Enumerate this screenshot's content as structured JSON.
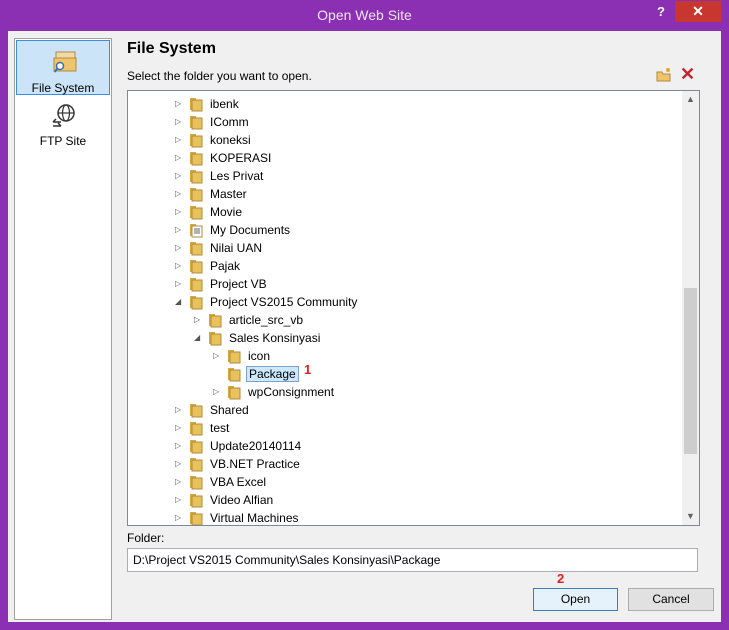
{
  "window": {
    "title": "Open Web Site",
    "help_label": "?",
    "close_label": "✕"
  },
  "nav": {
    "items": [
      {
        "label": "File System",
        "selected": true
      },
      {
        "label": "FTP Site",
        "selected": false
      }
    ]
  },
  "heading": "File System",
  "instruction": "Select the folder you want to open.",
  "tree": {
    "rows": [
      {
        "label": "ibenk",
        "level": 0,
        "arrow": "▷"
      },
      {
        "label": "IComm",
        "level": 0,
        "arrow": "▷"
      },
      {
        "label": "koneksi",
        "level": 0,
        "arrow": "▷"
      },
      {
        "label": "KOPERASI",
        "level": 0,
        "arrow": "▷"
      },
      {
        "label": "Les Privat",
        "level": 0,
        "arrow": "▷"
      },
      {
        "label": "Master",
        "level": 0,
        "arrow": "▷"
      },
      {
        "label": "Movie",
        "level": 0,
        "arrow": "▷"
      },
      {
        "label": "My Documents",
        "level": 0,
        "arrow": "▷",
        "icon": "doc"
      },
      {
        "label": "Nilai UAN",
        "level": 0,
        "arrow": "▷"
      },
      {
        "label": "Pajak",
        "level": 0,
        "arrow": "▷"
      },
      {
        "label": "Project VB",
        "level": 0,
        "arrow": "▷"
      },
      {
        "label": "Project VS2015 Community",
        "level": 0,
        "arrow": "◢"
      },
      {
        "label": "article_src_vb",
        "level": 1,
        "arrow": "▷"
      },
      {
        "label": "Sales Konsinyasi",
        "level": 1,
        "arrow": "◢"
      },
      {
        "label": "icon",
        "level": 2,
        "arrow": "▷"
      },
      {
        "label": "Package",
        "level": 2,
        "arrow": "",
        "selected": true
      },
      {
        "label": "wpConsignment",
        "level": 2,
        "arrow": "▷"
      },
      {
        "label": "Shared",
        "level": 0,
        "arrow": "▷"
      },
      {
        "label": "test",
        "level": 0,
        "arrow": "▷"
      },
      {
        "label": "Update20140114",
        "level": 0,
        "arrow": "▷"
      },
      {
        "label": "VB.NET Practice",
        "level": 0,
        "arrow": "▷"
      },
      {
        "label": "VBA Excel",
        "level": 0,
        "arrow": "▷"
      },
      {
        "label": "Video Alfian",
        "level": 0,
        "arrow": "▷"
      },
      {
        "label": "Virtual Machines",
        "level": 0,
        "arrow": "▷"
      }
    ]
  },
  "annotations": {
    "one": "1",
    "two": "2"
  },
  "folder": {
    "label": "Folder:",
    "value": "D:\\Project VS2015 Community\\Sales Konsinyasi\\Package"
  },
  "buttons": {
    "open": "Open",
    "cancel": "Cancel"
  },
  "colors": {
    "accent": "#8b2fb3",
    "close": "#c7372f",
    "annotation": "#e02020",
    "folder": "#e8c25a"
  }
}
